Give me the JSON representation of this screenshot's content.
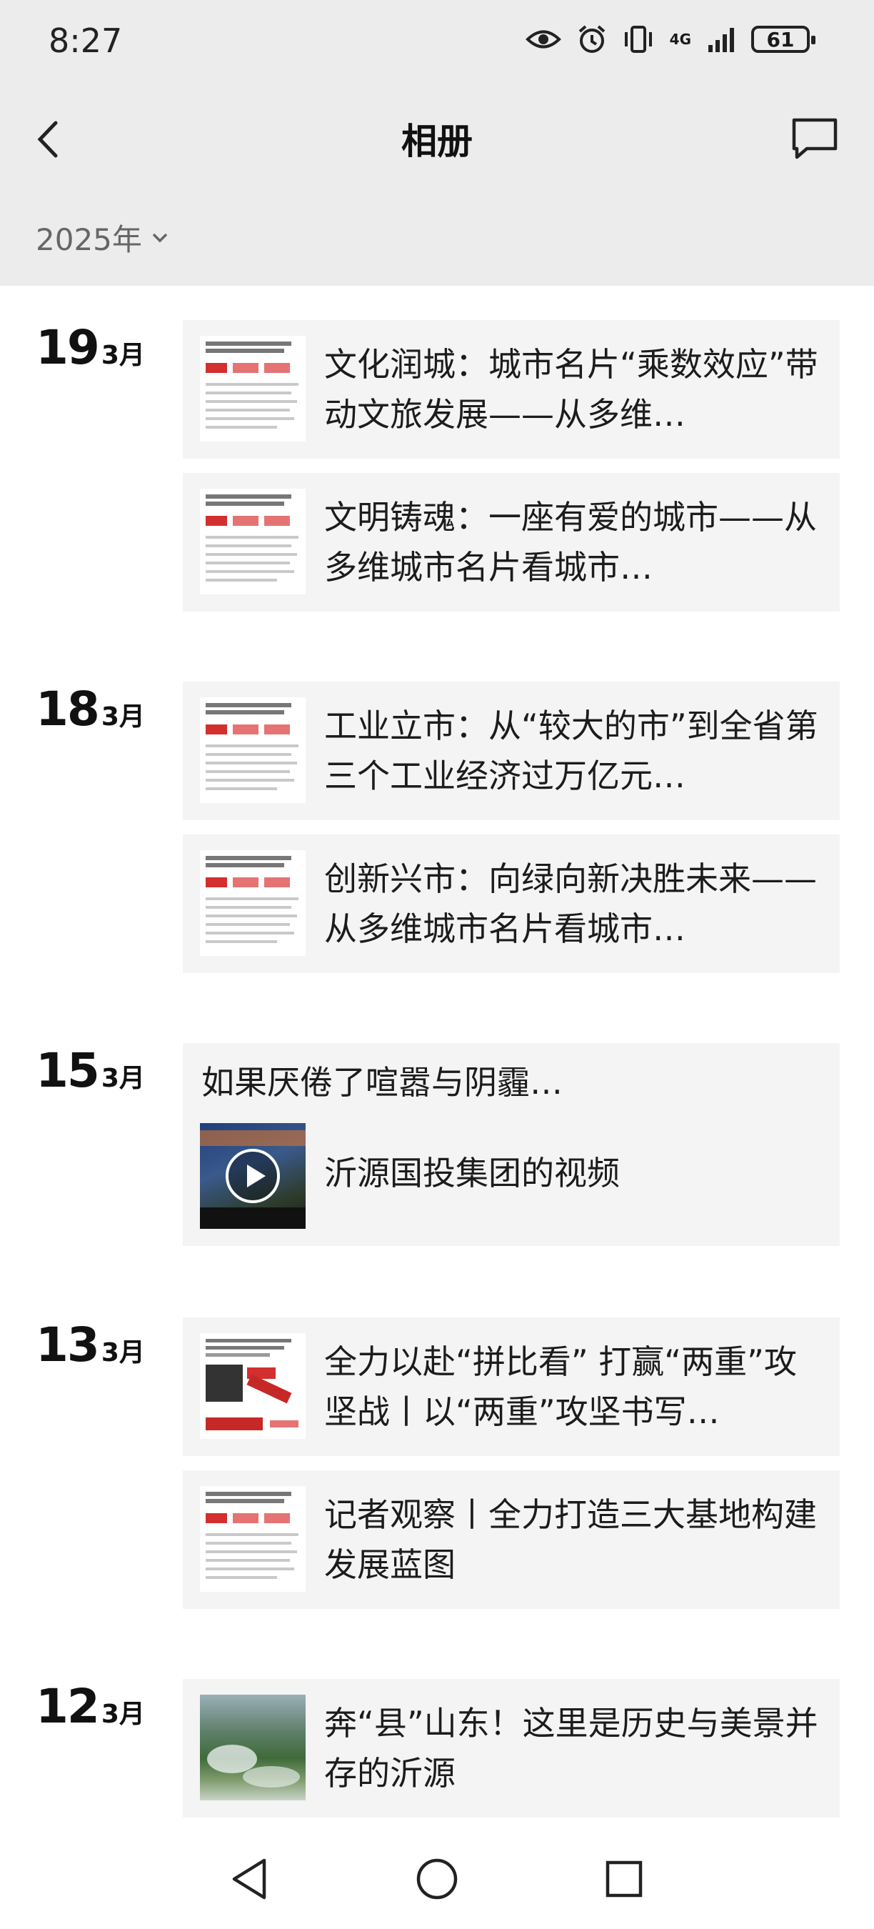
{
  "status": {
    "time": "8:27",
    "network": "4G",
    "battery": "61"
  },
  "header": {
    "title": "相册",
    "year": "2025年"
  },
  "colors": {
    "header_bg": "#ececec",
    "card_bg": "#f4f4f4"
  },
  "groups": [
    {
      "day": "19",
      "month": "3月",
      "items": [
        {
          "text": "文化润城：城市名片“乘数效应”带动文旅发展——从多维…",
          "thumb": "article"
        },
        {
          "text": "文明铸魂：一座有爱的城市——从多维城市名片看城市…",
          "thumb": "article"
        }
      ]
    },
    {
      "day": "18",
      "month": "3月",
      "items": [
        {
          "text": "工业立市：从“较大的市”到全省第三个工业经济过万亿元…",
          "thumb": "article"
        },
        {
          "text": "创新兴市：向绿向新决胜未来——从多维城市名片看城市…",
          "thumb": "article"
        }
      ]
    },
    {
      "day": "15",
      "month": "3月",
      "post_text": "如果厌倦了喧嚣与阴霾…",
      "items": [
        {
          "text": "沂源国投集团的视频",
          "thumb": "video"
        }
      ]
    },
    {
      "day": "13",
      "month": "3月",
      "items": [
        {
          "text": "全力以赴“拼比看” 打赢“两重”攻坚战丨以“两重”攻坚书写…",
          "thumb": "newspaper"
        },
        {
          "text": "记者观察丨全力打造三大基地构建发展蓝图",
          "thumb": "article"
        }
      ]
    },
    {
      "day": "12",
      "month": "3月",
      "items": [
        {
          "text": "奔“县”山东！这里是历史与美景并存的沂源",
          "thumb": "landscape"
        }
      ]
    }
  ]
}
